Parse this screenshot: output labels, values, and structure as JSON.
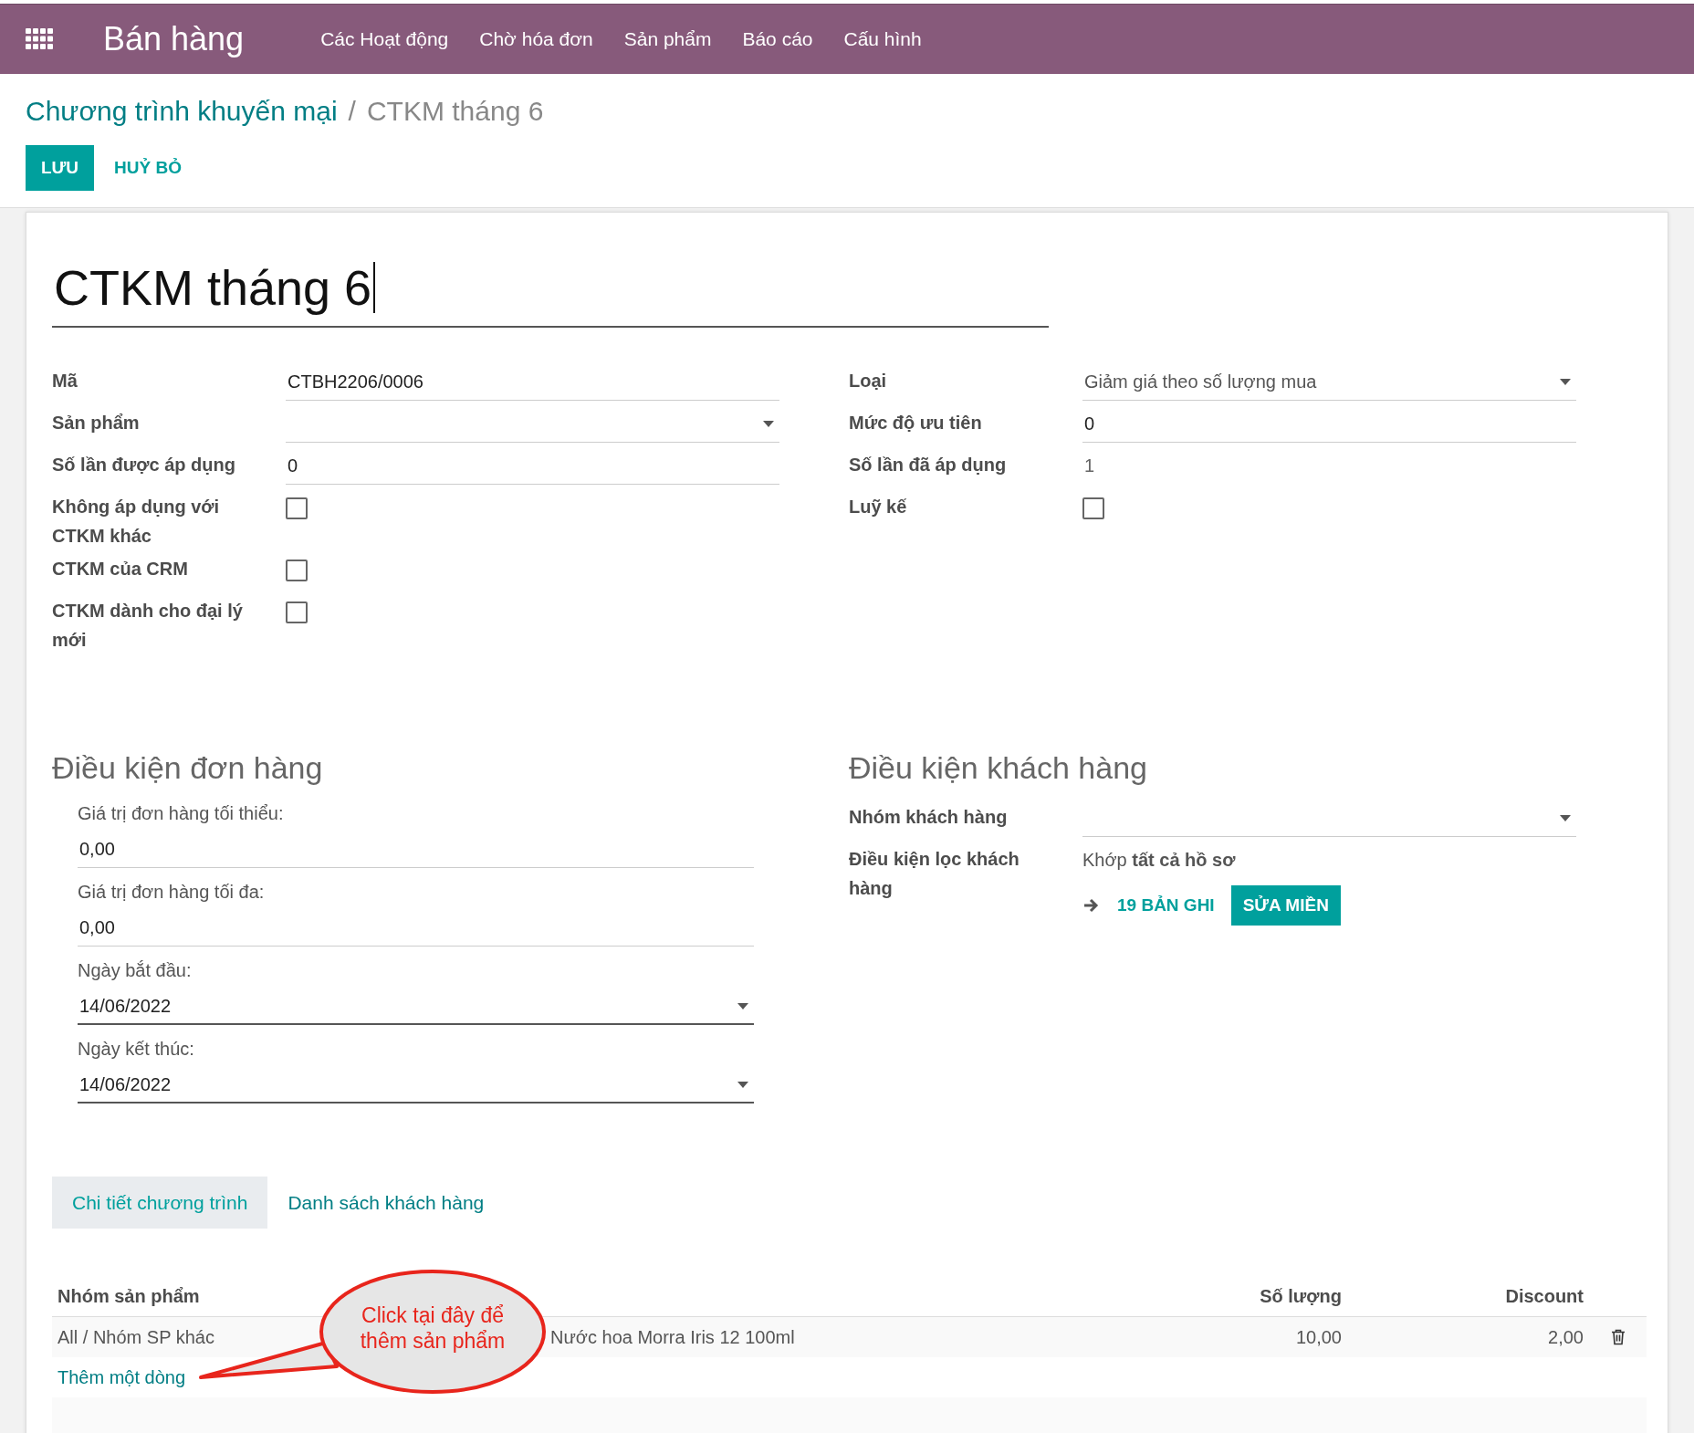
{
  "app_bar": {
    "app_name": "Bán hàng",
    "menu": [
      "Các Hoạt động",
      "Chờ hóa đơn",
      "Sản phẩm",
      "Báo cáo",
      "Cấu hình"
    ]
  },
  "breadcrumb": {
    "parent": "Chương trình khuyến mại",
    "separator": "/",
    "current": "CTKM tháng 6"
  },
  "actions": [
    {
      "kind": "primary",
      "label": "LƯU"
    },
    {
      "kind": "link",
      "label": "HUỶ BỎ"
    }
  ],
  "title": "CTKM tháng 6",
  "left_fields": [
    {
      "kind": "text",
      "label": "Mã",
      "value": "CTBH2206/0006"
    },
    {
      "kind": "select",
      "label": "Sản phẩm"
    },
    {
      "kind": "text",
      "label": "Số lần được áp dụng",
      "value": "0"
    },
    {
      "kind": "checkbox",
      "label": "Không áp dụng với CTKM khác",
      "checked": false
    },
    {
      "kind": "checkbox",
      "label": "CTKM của CRM",
      "checked": false
    },
    {
      "kind": "checkbox",
      "label": "CTKM dành cho đại lý mới",
      "checked": false
    }
  ],
  "right_fields": [
    {
      "kind": "select",
      "label": "Loại",
      "value": "Giảm giá theo số lượng mua"
    },
    {
      "kind": "text",
      "label": "Mức độ ưu tiên",
      "value": "0"
    },
    {
      "kind": "readonly",
      "label": "Số lần đã áp dụng",
      "value": "1"
    },
    {
      "kind": "checkbox",
      "label": "Luỹ kế",
      "checked": false
    }
  ],
  "order_conditions": {
    "heading": "Điều kiện đơn hàng",
    "fields": [
      {
        "kind": "text",
        "label": "Giá trị đơn hàng tối thiểu:",
        "value": "0,00"
      },
      {
        "kind": "text",
        "label": "Giá trị đơn hàng tối đa:",
        "value": "0,00"
      },
      {
        "kind": "date",
        "label": "Ngày bắt đầu:",
        "value": "14/06/2022"
      },
      {
        "kind": "date",
        "label": "Ngày kết thúc:",
        "value": "14/06/2022"
      }
    ]
  },
  "customer_conditions": {
    "heading": "Điều kiện khách hàng",
    "fields": [
      {
        "kind": "select",
        "label": "Nhóm khách hàng"
      },
      {
        "kind": "domain",
        "label": "Điều kiện lọc khách hàng",
        "value": "Khớp **tất cả hồ sơ**",
        "records": "19 BẢN GHI",
        "button": "SỬA MIỀN"
      }
    ]
  },
  "tabs": [
    {
      "label": "Chi tiết chương trình",
      "selected": true
    },
    {
      "label": "Danh sách khách hàng",
      "selected": false
    }
  ],
  "table": {
    "columns": [
      "Nhóm sản phẩm",
      "",
      "Số lượng",
      "Discount"
    ],
    "rows": [
      {
        "cells": [
          "All / Nhóm SP khác",
          "Nước hoa Morra Iris 12 100ml",
          "10,00",
          "2,00"
        ]
      }
    ],
    "add_line": "Thêm một dòng"
  },
  "callout": {
    "text": "Click tại đây để thêm sản phẩm"
  }
}
